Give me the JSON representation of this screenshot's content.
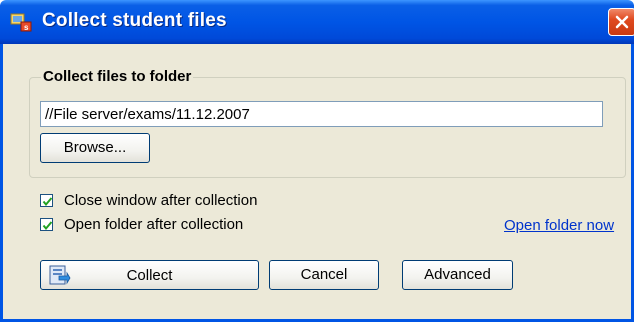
{
  "window": {
    "title": "Collect student files",
    "title_color": "#0055e5",
    "icons": {
      "app": "app-icon",
      "close": "close-icon"
    }
  },
  "folder_group": {
    "label": "Collect files to folder",
    "path_value": "//File server/exams/11.12.2007",
    "browse_label": "Browse..."
  },
  "options": {
    "close_window": {
      "label": "Close window after collection",
      "checked": true
    },
    "open_folder": {
      "label": "Open folder after collection",
      "checked": true
    }
  },
  "open_folder_now_link": "Open folder now",
  "buttons": {
    "collect": {
      "label": "Collect",
      "icon": "collect-icon"
    },
    "cancel": "Cancel",
    "advanced": "Advanced"
  }
}
